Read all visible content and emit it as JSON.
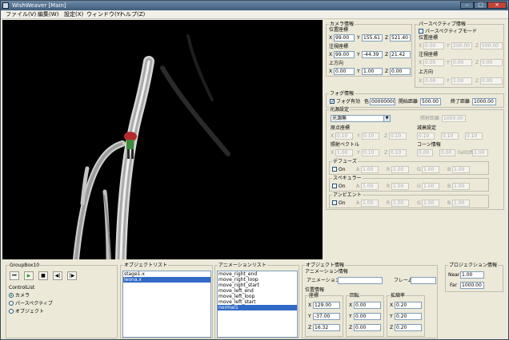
{
  "window": {
    "title": "WishWeaver [Main]"
  },
  "menu": [
    "ファイル(V)",
    "編集(W)",
    "設定(X)",
    "ウィンドウ(Y)",
    "ヘルプ(Z)"
  ],
  "camera": {
    "title": "カメラ情報",
    "pos_label": "位置座標",
    "pos": [
      "99.00",
      "155.61",
      "521.40"
    ],
    "look_label": "注視座標",
    "look": [
      "99.00",
      "-44.39",
      "21.42"
    ],
    "up_label": "上方向",
    "up": [
      "0.00",
      "1.00",
      "0.00"
    ]
  },
  "perspective": {
    "title": "パースペクティブ情報",
    "mode_label": "パースペクティブモード",
    "pos_label": "位置座標",
    "pos": [
      "0.00",
      "200.00",
      "500.00"
    ],
    "look_label": "注視座標",
    "look": [
      "0.00",
      "0.00",
      "0.00"
    ],
    "up_label": "上方向",
    "up": [
      "0.00",
      "1.00",
      "0.00"
    ]
  },
  "axis": {
    "x": "X",
    "y": "Y",
    "z": "Z"
  },
  "fog": {
    "title": "フォグ情報",
    "enable_label": "フォグ有効",
    "color_label": "色",
    "color_value": "00000000",
    "start_label": "開始距離",
    "start_value": "500.00",
    "end_label": "終了距離",
    "end_value": "1000.00"
  },
  "light": {
    "title": "光源設定",
    "type_value": "光源無",
    "range_label": "照射距離",
    "range_value": "1000.00",
    "origin_label": "原点座標",
    "origin": [
      "0.10",
      "0.10",
      "0.10"
    ],
    "atten_label": "減衰設定",
    "atten": [
      "0.10",
      "0.10",
      "0.10"
    ],
    "dir_label": "照射ベクトル",
    "dir": [
      "1.00",
      "0.10",
      "0.10"
    ],
    "cone_label": "コーン情報",
    "cone_theta": "0.00",
    "cone_phi": "0.00",
    "falloff_label": "FallOff",
    "falloff_value": "1.00",
    "diffuse_label": "デフューズ",
    "specular_label": "スペキュラー",
    "ambient_label": "アンビエント",
    "on_label": "On",
    "a_label": "A",
    "r_label": "R",
    "g_label": "G",
    "b_label": "B",
    "color_value": "1.00"
  },
  "groupbox": {
    "title": "GroupBox10"
  },
  "control_list": {
    "title": "ControlList",
    "options": [
      "カメラ",
      "パースペクティブ",
      "オブジェクト"
    ]
  },
  "object_list": {
    "title": "オブジェクトリスト",
    "items": [
      "stage1.x",
      "leona.x"
    ]
  },
  "anim_list": {
    "title": "アニメーションリスト",
    "items": [
      "move_right_end",
      "move_right_loop",
      "move_right_start",
      "move_left_end",
      "move_left_loop",
      "move_left_start",
      "normal1"
    ]
  },
  "object_info": {
    "title": "オブジェクト情報",
    "anim_info_label": "アニメーション情報",
    "anim_name_label": "アニメーション名",
    "frame_label": "フレーム",
    "pos_info_label": "位置情報",
    "coord_label": "座標",
    "coord": [
      "129.00",
      "-37.00",
      "16.32"
    ],
    "rot_label": "回転",
    "rot": [
      "0.00",
      "0.00",
      "0.00"
    ],
    "scale_label": "拡縮率",
    "scale": [
      "0.20",
      "0.20",
      "0.20"
    ]
  },
  "projection": {
    "title": "プロジェクション情報",
    "near_label": "Near",
    "near_value": "1.00",
    "far_label": "Far",
    "far_value": "1000.00"
  },
  "colors": {
    "viewport_bg": "#000000",
    "selection": "#316ac5",
    "titlebar": "#4b6a8a",
    "close": "#c0443a"
  }
}
